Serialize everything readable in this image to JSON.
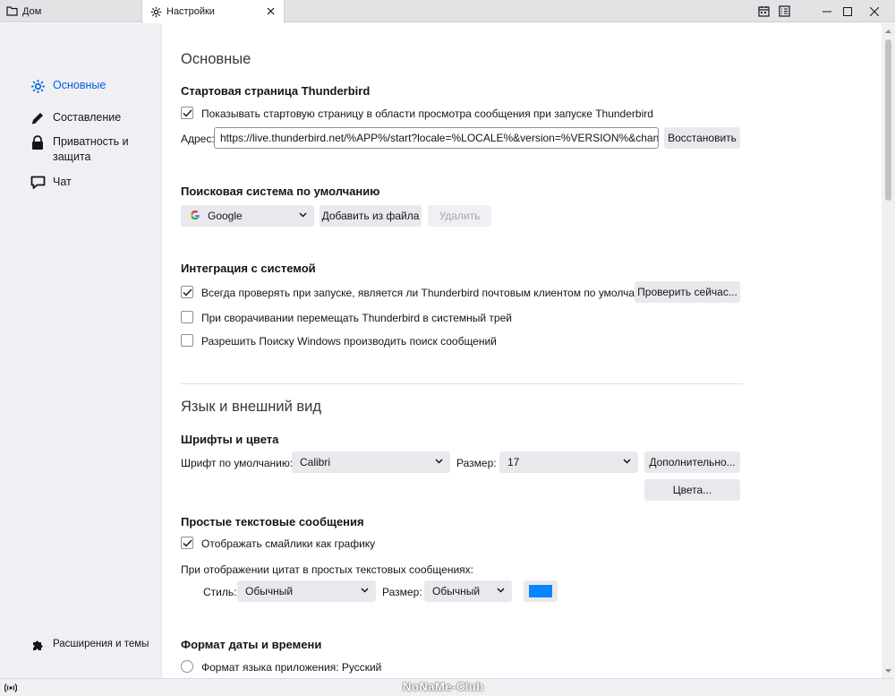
{
  "tabs": [
    {
      "label": "Дом",
      "icon": "folder-icon"
    },
    {
      "label": "Настройки",
      "icon": "gear-icon"
    }
  ],
  "sidebar": {
    "items": [
      {
        "label": "Основные",
        "icon": "gear-icon",
        "active": true
      },
      {
        "label": "Составление",
        "icon": "pencil-icon"
      },
      {
        "label": "Приватность и защита",
        "icon": "lock-icon"
      },
      {
        "label": "Чат",
        "icon": "chat-icon"
      }
    ],
    "extensions": "Расширения и темы"
  },
  "general": {
    "title": "Основные",
    "start_page": {
      "heading": "Стартовая страница Thunderbird",
      "show_checkbox": "Показывать стартовую страницу в области просмотра сообщения при запуске Thunderbird",
      "address_label": "Адрес:",
      "address_value": "https://live.thunderbird.net/%APP%/start?locale=%LOCALE%&version=%VERSION%&channel=%C",
      "restore_button": "Восстановить"
    },
    "search": {
      "heading": "Поисковая система по умолчанию",
      "engine": "Google",
      "add_button": "Добавить из файла",
      "remove_button": "Удалить"
    },
    "integration": {
      "heading": "Интеграция с системой",
      "default_check": "Всегда проверять при запуске, является ли Thunderbird почтовым клиентом по умолчанию",
      "check_now_button": "Проверить сейчас...",
      "tray_check": "При сворачивании перемещать Thunderbird в системный трей",
      "windows_search": "Разрешить Поиску Windows производить поиск сообщений"
    }
  },
  "appearance": {
    "title": "Язык и внешний вид",
    "fonts": {
      "heading": "Шрифты и цвета",
      "default_font_label": "Шрифт по умолчанию:",
      "default_font_value": "Calibri",
      "size_label": "Размер:",
      "size_value": "17",
      "advanced_button": "Дополнительно...",
      "colors_button": "Цвета..."
    },
    "plain_text": {
      "heading": "Простые текстовые сообщения",
      "emoticons_check": "Отображать смайлики как графику",
      "quotes_label": "При отображении цитат в простых текстовых сообщениях:",
      "style_label": "Стиль:",
      "style_value": "Обычный",
      "size_label": "Размер:",
      "size_value": "Обычный",
      "quote_color": "#0a84ff"
    },
    "datetime": {
      "heading": "Формат даты и времени",
      "app_locale_radio": "Формат языка приложения: Русский"
    }
  },
  "statusbar": {
    "watermark": "NoNaMe-Club"
  },
  "colors": {
    "accent": "#0061e0",
    "sidebar_bg": "#f0f0f4",
    "button_bg": "#e9e9ed"
  }
}
